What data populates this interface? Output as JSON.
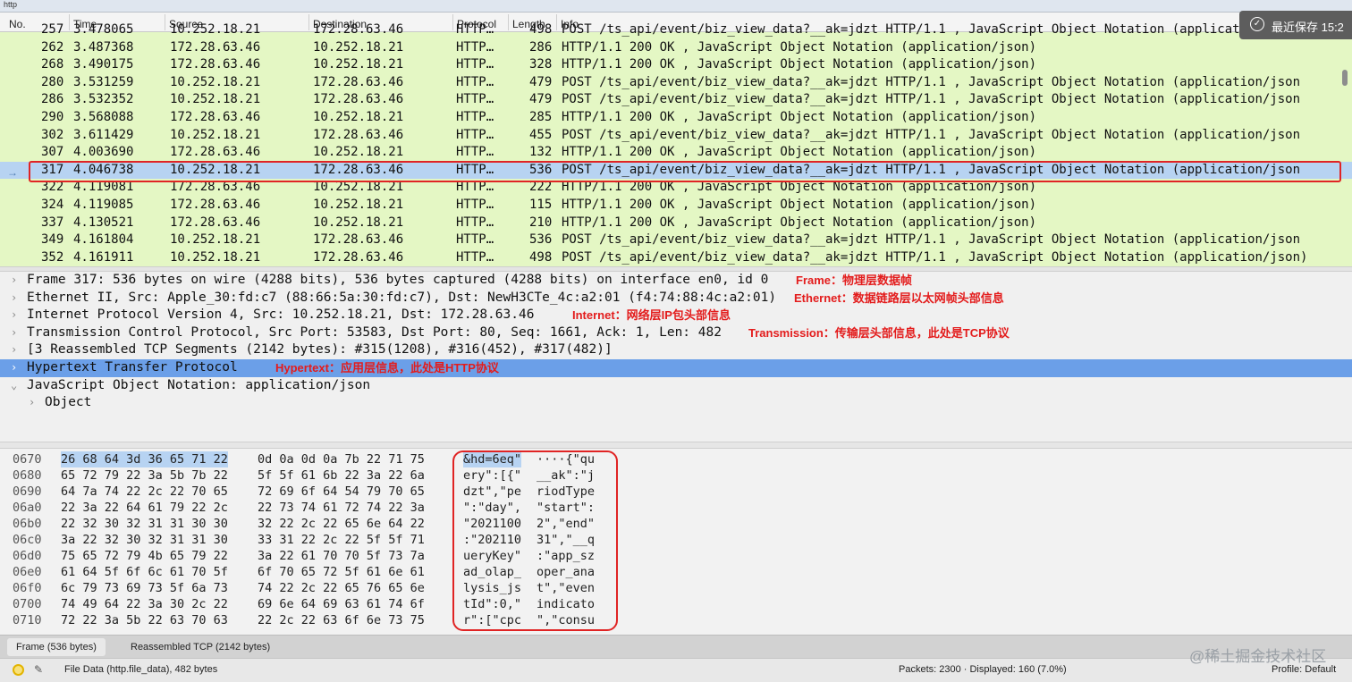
{
  "filter_bar": {
    "value": "http"
  },
  "packet_list": {
    "columns": [
      "No.",
      "Time",
      "Source",
      "Destination",
      "Protocol",
      "Length",
      "Info"
    ],
    "partial_row": {
      "no": "257",
      "time": "3.478065",
      "source": "10.252.18.21",
      "destination": "172.28.63.46",
      "protocol": "HTTP…",
      "length": "498",
      "info": "POST /ts_api/event/biz_view_data?__ak=jdzt HTTP/1.1 , JavaScript Object Notation (application/json"
    },
    "rows": [
      {
        "no": "262",
        "time": "3.487368",
        "source": "172.28.63.46",
        "destination": "10.252.18.21",
        "protocol": "HTTP…",
        "length": "286",
        "info": "HTTP/1.1 200 OK , JavaScript Object Notation (application/json)"
      },
      {
        "no": "268",
        "time": "3.490175",
        "source": "172.28.63.46",
        "destination": "10.252.18.21",
        "protocol": "HTTP…",
        "length": "328",
        "info": "HTTP/1.1 200 OK , JavaScript Object Notation (application/json)"
      },
      {
        "no": "280",
        "time": "3.531259",
        "source": "10.252.18.21",
        "destination": "172.28.63.46",
        "protocol": "HTTP…",
        "length": "479",
        "info": "POST /ts_api/event/biz_view_data?__ak=jdzt HTTP/1.1 , JavaScript Object Notation (application/json"
      },
      {
        "no": "286",
        "time": "3.532352",
        "source": "10.252.18.21",
        "destination": "172.28.63.46",
        "protocol": "HTTP…",
        "length": "479",
        "info": "POST /ts_api/event/biz_view_data?__ak=jdzt HTTP/1.1 , JavaScript Object Notation (application/json"
      },
      {
        "no": "290",
        "time": "3.568088",
        "source": "172.28.63.46",
        "destination": "10.252.18.21",
        "protocol": "HTTP…",
        "length": "285",
        "info": "HTTP/1.1 200 OK , JavaScript Object Notation (application/json)"
      },
      {
        "no": "302",
        "time": "3.611429",
        "source": "10.252.18.21",
        "destination": "172.28.63.46",
        "protocol": "HTTP…",
        "length": "455",
        "info": "POST /ts_api/event/biz_view_data?__ak=jdzt HTTP/1.1 , JavaScript Object Notation (application/json"
      },
      {
        "no": "307",
        "time": "4.003690",
        "source": "172.28.63.46",
        "destination": "10.252.18.21",
        "protocol": "HTTP…",
        "length": "132",
        "info": "HTTP/1.1 200 OK , JavaScript Object Notation (application/json)"
      },
      {
        "no": "317",
        "time": "4.046738",
        "source": "10.252.18.21",
        "destination": "172.28.63.46",
        "protocol": "HTTP…",
        "length": "536",
        "info": "POST /ts_api/event/biz_view_data?__ak=jdzt HTTP/1.1 , JavaScript Object Notation (application/json"
      },
      {
        "no": "322",
        "time": "4.119081",
        "source": "172.28.63.46",
        "destination": "10.252.18.21",
        "protocol": "HTTP…",
        "length": "222",
        "info": "HTTP/1.1 200 OK , JavaScript Object Notation (application/json)"
      },
      {
        "no": "324",
        "time": "4.119085",
        "source": "172.28.63.46",
        "destination": "10.252.18.21",
        "protocol": "HTTP…",
        "length": "115",
        "info": "HTTP/1.1 200 OK , JavaScript Object Notation (application/json)"
      },
      {
        "no": "337",
        "time": "4.130521",
        "source": "172.28.63.46",
        "destination": "10.252.18.21",
        "protocol": "HTTP…",
        "length": "210",
        "info": "HTTP/1.1 200 OK , JavaScript Object Notation (application/json)"
      },
      {
        "no": "349",
        "time": "4.161804",
        "source": "10.252.18.21",
        "destination": "172.28.63.46",
        "protocol": "HTTP…",
        "length": "536",
        "info": "POST /ts_api/event/biz_view_data?__ak=jdzt HTTP/1.1 , JavaScript Object Notation (application/json"
      },
      {
        "no": "352",
        "time": "4.161911",
        "source": "10.252.18.21",
        "destination": "172.28.63.46",
        "protocol": "HTTP…",
        "length": "498",
        "info": "POST /ts_api/event/biz_view_data?__ak=jdzt HTTP/1.1 , JavaScript Object Notation (application/json)"
      }
    ],
    "selected_no": "317"
  },
  "details": [
    {
      "text": "Frame 317: 536 bytes on wire (4288 bits), 536 bytes captured (4288 bits) on interface en0, id 0",
      "annotation": "Frame：物理层数据帧"
    },
    {
      "text": "Ethernet II, Src: Apple_30:fd:c7 (88:66:5a:30:fd:c7), Dst: NewH3CTe_4c:a2:01 (f4:74:88:4c:a2:01)",
      "annotation": "Ethernet：数据链路层以太网帧头部信息"
    },
    {
      "text": "Internet Protocol Version 4, Src: 10.252.18.21, Dst: 172.28.63.46",
      "annotation": "Internet：网络层IP包头部信息"
    },
    {
      "text": "Transmission Control Protocol, Src Port: 53583, Dst Port: 80, Seq: 1661, Ack: 1, Len: 482",
      "annotation": "Transmission：传输层头部信息，此处是TCP协议"
    },
    {
      "text": "[3 Reassembled TCP Segments (2142 bytes): #315(1208), #316(452), #317(482)]",
      "annotation": ""
    },
    {
      "text": "Hypertext Transfer Protocol",
      "annotation": "Hypertext：应用层信息，此处是HTTP协议"
    },
    {
      "text": "JavaScript Object Notation: application/json",
      "annotation": ""
    },
    {
      "text": "Object",
      "annotation": ""
    }
  ],
  "bytes": [
    {
      "offset": "0670",
      "hex1": "26 68 64 3d 36 65 71 22",
      "hex2": "0d 0a 0d 0a 7b 22 71 75",
      "ascii1": "&hd=6eq\"",
      "ascii2": "····{\"qu"
    },
    {
      "offset": "0680",
      "hex1": "65 72 79 22 3a 5b 7b 22",
      "hex2": "5f 5f 61 6b 22 3a 22 6a",
      "ascii1": "ery\":[{\"",
      "ascii2": "__ak\":\"j"
    },
    {
      "offset": "0690",
      "hex1": "64 7a 74 22 2c 22 70 65",
      "hex2": "72 69 6f 64 54 79 70 65",
      "ascii1": "dzt\",\"pe",
      "ascii2": "riodType"
    },
    {
      "offset": "06a0",
      "hex1": "22 3a 22 64 61 79 22 2c",
      "hex2": "22 73 74 61 72 74 22 3a",
      "ascii1": "\":\"day\",",
      "ascii2": "\"start\":"
    },
    {
      "offset": "06b0",
      "hex1": "22 32 30 32 31 31 30 30",
      "hex2": "32 22 2c 22 65 6e 64 22",
      "ascii1": "\"2021100",
      "ascii2": "2\",\"end\""
    },
    {
      "offset": "06c0",
      "hex1": "3a 22 32 30 32 31 31 30",
      "hex2": "33 31 22 2c 22 5f 5f 71",
      "ascii1": ":\"202110",
      "ascii2": "31\",\"__q"
    },
    {
      "offset": "06d0",
      "hex1": "75 65 72 79 4b 65 79 22",
      "hex2": "3a 22 61 70 70 5f 73 7a",
      "ascii1": "ueryKey\"",
      "ascii2": ":\"app_sz"
    },
    {
      "offset": "06e0",
      "hex1": "61 64 5f 6f 6c 61 70 5f",
      "hex2": "6f 70 65 72 5f 61 6e 61",
      "ascii1": "ad_olap_",
      "ascii2": "oper_ana"
    },
    {
      "offset": "06f0",
      "hex1": "6c 79 73 69 73 5f 6a 73",
      "hex2": "74 22 2c 22 65 76 65 6e",
      "ascii1": "lysis_js",
      "ascii2": "t\",\"even"
    },
    {
      "offset": "0700",
      "hex1": "74 49 64 22 3a 30 2c 22",
      "hex2": "69 6e 64 69 63 61 74 6f",
      "ascii1": "tId\":0,\"",
      "ascii2": "indicato"
    },
    {
      "offset": "0710",
      "hex1": "72 22 3a 5b 22 63 70 63",
      "hex2": "22 2c 22 63 6f 6e 73 75",
      "ascii1": "r\":[\"cpc",
      "ascii2": "\",\"consu"
    }
  ],
  "tabs": [
    "Frame (536 bytes)",
    "Reassembled TCP (2142 bytes)"
  ],
  "status": {
    "left": "File Data (http.file_data), 482 bytes",
    "packets": "Packets: 2300 · Displayed: 160 (7.0%)",
    "profile": "Profile: Default"
  },
  "overlay": {
    "autosave": "最近保存 15:2",
    "watermark": "@稀土掘金技术社区"
  },
  "colors": {
    "list_bg": "#e4f7c4",
    "selected_row": "#b7d3f2",
    "highlight_row": "#6b9fe8",
    "annotation": "#e31c1c"
  },
  "icons": [
    "right-arrow-icon",
    "chevron-right-icon",
    "chevron-down-icon",
    "checkmark-circle-icon",
    "status-indicator-icon",
    "edit-icon"
  ]
}
